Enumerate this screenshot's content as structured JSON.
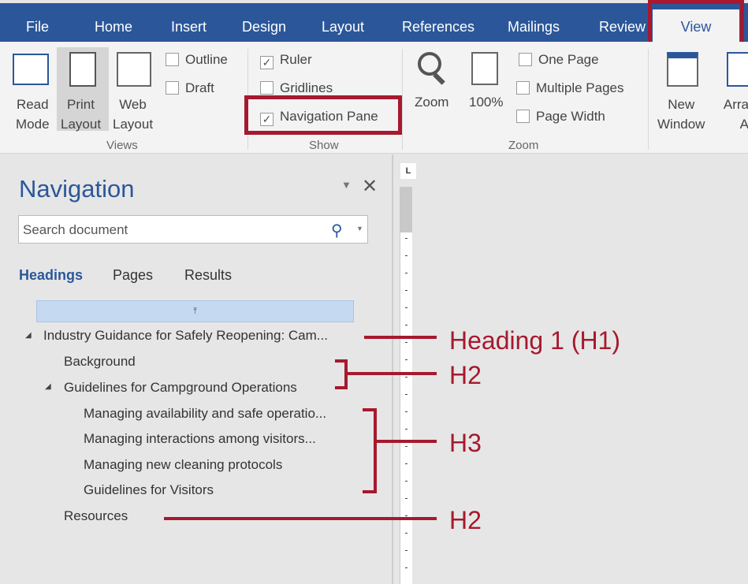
{
  "tabs": [
    "File",
    "Home",
    "Insert",
    "Design",
    "Layout",
    "References",
    "Mailings",
    "Review",
    "View"
  ],
  "ribbon": {
    "views": {
      "read_mode": [
        "Read",
        "Mode"
      ],
      "print_layout": [
        "Print",
        "Layout"
      ],
      "web_layout": [
        "Web",
        "Layout"
      ],
      "outline": "Outline",
      "draft": "Draft",
      "group": "Views"
    },
    "show": {
      "ruler": "Ruler",
      "ruler_checked": true,
      "gridlines": "Gridlines",
      "gridlines_checked": false,
      "navigation_pane": "Navigation Pane",
      "navigation_pane_checked": true,
      "group": "Show"
    },
    "zoom": {
      "zoom": "Zoom",
      "hundred": "100%",
      "one_page": "One Page",
      "multiple_pages": "Multiple Pages",
      "page_width": "Page Width",
      "group": "Zoom"
    },
    "window": {
      "new_window": [
        "New",
        "Window"
      ],
      "arrange": [
        "Arra",
        "A"
      ]
    }
  },
  "nav": {
    "title": "Navigation",
    "search_placeholder": "Search document",
    "tabs": [
      "Headings",
      "Pages",
      "Results"
    ],
    "headings": [
      "Industry Guidance for Safely Reopening: Cam...",
      "Background",
      "Guidelines for Campground Operations",
      "Managing availability and safe operatio...",
      "Managing interactions among visitors...",
      "Managing new cleaning protocols",
      "Guidelines for Visitors",
      "Resources"
    ]
  },
  "annotations": [
    "Heading 1 (H1)",
    "H2",
    "H3",
    "H2"
  ],
  "colors": {
    "tabbar": "#2b579a",
    "annotation": "#a6192e",
    "selected_heading": "#c5d9f1"
  }
}
